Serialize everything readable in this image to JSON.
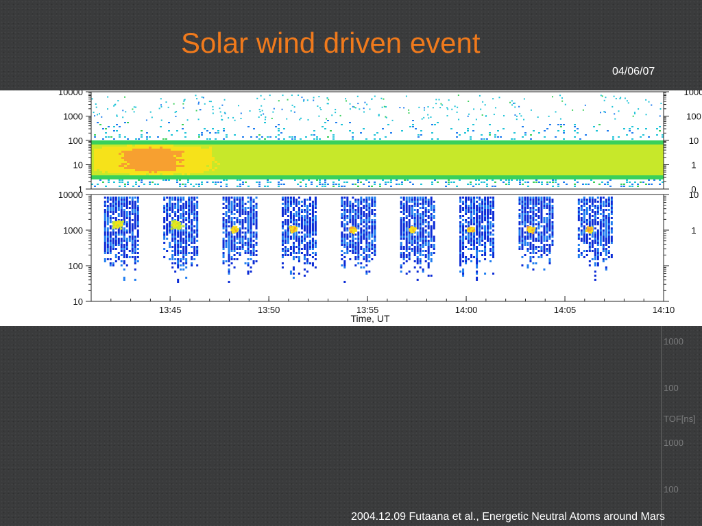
{
  "slide": {
    "title": "Solar wind driven event",
    "date": "04/06/07",
    "footer": "2004.12.09 Futaana et al., Energetic Neutral Atoms around Mars",
    "background_color": "#3a3b3c",
    "title_color": "#f07a1c"
  },
  "right_ticks": [
    "1000",
    "100",
    "TOF[ns]",
    "1000",
    "100"
  ],
  "chart_data": {
    "type": "heatmap",
    "xlabel": "Time, UT",
    "x_ticks": [
      "13:45",
      "13:50",
      "13:55",
      "14:00",
      "14:05",
      "14:10"
    ],
    "x_range": [
      "13:41",
      "14:10"
    ],
    "y_scale": "log",
    "colormap": [
      "#0b2bd6",
      "#1f7df0",
      "#1fc4d8",
      "#39d05a",
      "#c7e82a",
      "#f6e21a",
      "#f7a030"
    ],
    "panels": [
      {
        "y_ticks": [
          "10000",
          "1000",
          "100",
          "10",
          "1"
        ],
        "y_range": [
          1,
          10000
        ],
        "right_tick_fragments": [
          "1000",
          "100",
          "10",
          "1",
          "0"
        ],
        "features": [
          {
            "kind": "band",
            "y_low": 3,
            "y_high": 100,
            "peak": "orange",
            "peak_time_range": [
              "13:41",
              "13:47"
            ]
          }
        ]
      },
      {
        "y_ticks": [
          "10000",
          "1000",
          "100",
          "10"
        ],
        "y_range": [
          10,
          10000
        ],
        "right_tick_fragments": [
          "10",
          "1"
        ],
        "features": [
          {
            "kind": "spin_burst",
            "time": "13:42"
          },
          {
            "kind": "spin_burst",
            "time": "13:45"
          },
          {
            "kind": "spin_burst",
            "time": "13:48"
          },
          {
            "kind": "spin_burst",
            "time": "13:51"
          },
          {
            "kind": "spin_burst",
            "time": "13:54"
          },
          {
            "kind": "spin_burst",
            "time": "13:57"
          },
          {
            "kind": "spin_burst",
            "time": "14:00"
          },
          {
            "kind": "spin_burst",
            "time": "14:03"
          },
          {
            "kind": "spin_burst",
            "time": "14:06"
          }
        ]
      }
    ]
  }
}
